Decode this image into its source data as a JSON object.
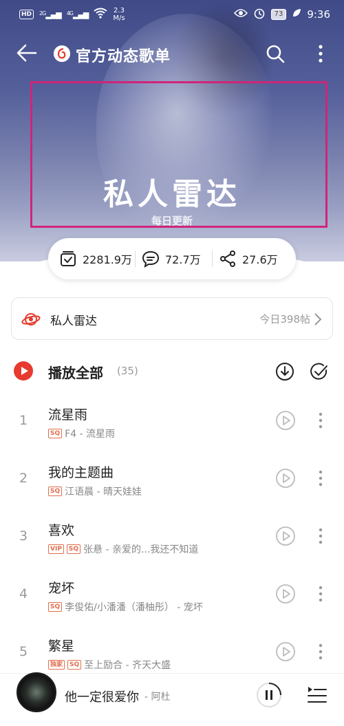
{
  "status_bar": {
    "hd": "HD",
    "sim1": "2",
    "net1": "2G",
    "net2": "4G",
    "speed_value": "2.3",
    "speed_unit": "M/s",
    "battery": "73",
    "time": "9:36"
  },
  "nav": {
    "title": "官方动态歌单"
  },
  "hero": {
    "title": "私人雷达",
    "subtitle": "每日更新"
  },
  "stats": {
    "collect": "2281.9万",
    "comments": "72.7万",
    "shares": "27.6万"
  },
  "radar_card": {
    "label": "私人雷达",
    "info": "今日398帖"
  },
  "play_all": {
    "label": "播放全部",
    "count": "(35)"
  },
  "songs": [
    {
      "num": "1",
      "title": "流星雨",
      "tags": [
        "SQ"
      ],
      "meta": "F4 - 流星雨"
    },
    {
      "num": "2",
      "title": "我的主题曲",
      "tags": [
        "SQ"
      ],
      "meta": "江语晨 - 晴天娃娃"
    },
    {
      "num": "3",
      "title": "喜欢",
      "tags": [
        "VIP",
        "SQ"
      ],
      "meta": "张悬 - 亲爱的...我还不知道"
    },
    {
      "num": "4",
      "title": "宠坏",
      "tags": [
        "SQ"
      ],
      "meta": "李俊佑/小潘潘（潘柚彤） - 宠坏"
    },
    {
      "num": "5",
      "title": "繁星",
      "tags": [
        "独家",
        "SQ"
      ],
      "meta": "至上励合 - 齐天大盛"
    }
  ],
  "player": {
    "title": "他一定很爱你",
    "artist": "- 阿杜"
  },
  "colors": {
    "accent": "#e63b2e",
    "highlight_frame": "#d0247a",
    "tag": "#e26d4c"
  }
}
